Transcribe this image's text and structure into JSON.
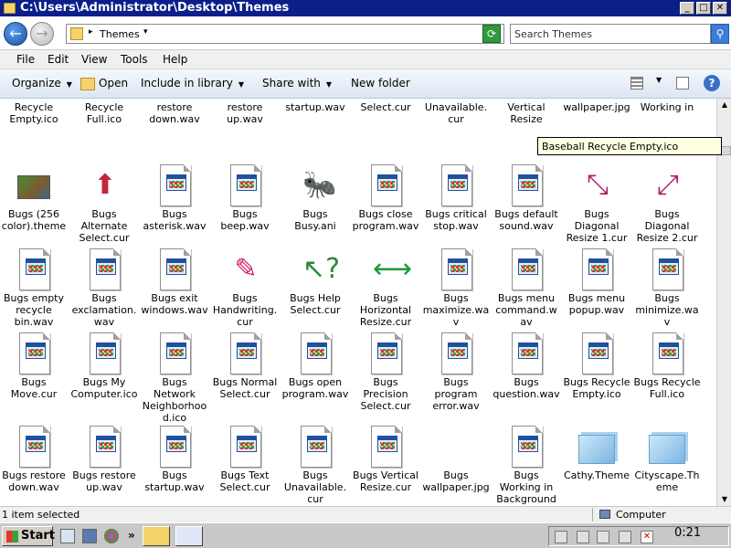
{
  "window": {
    "title": "C:\\Users\\Administrator\\Desktop\\Themes",
    "controls": {
      "minimize": "_",
      "maximize": "□",
      "close": "✕"
    }
  },
  "address": {
    "crumb": "Themes",
    "search_placeholder": "Search Themes"
  },
  "menu": [
    "File",
    "Edit",
    "View",
    "Tools",
    "Help"
  ],
  "toolbar": {
    "organize": "Organize",
    "open": "Open",
    "include_in_library": "Include in library",
    "share_with": "Share with",
    "new_folder": "New folder"
  },
  "tooltip": "Baseball Recycle Empty.ico",
  "items": [
    {
      "label": "Baseball Recycle Empty.ico",
      "kind": "partial"
    },
    {
      "label": "Baseball Recycle Full.ico",
      "kind": "partial"
    },
    {
      "label": "Baseball restore down.wav",
      "kind": "partial"
    },
    {
      "label": "Baseball restore up.wav",
      "kind": "partial"
    },
    {
      "label": "Baseball startup.wav",
      "kind": "partial"
    },
    {
      "label": "Baseball Text Select.cur",
      "kind": "partial"
    },
    {
      "label": "Baseball Unavailable. cur",
      "kind": "partial"
    },
    {
      "label": "Baseball Vertical Resize",
      "kind": "partial"
    },
    {
      "label": "Baseball wallpaper.jpg",
      "kind": "partial"
    },
    {
      "label": "Baseball Working in",
      "kind": "partial"
    },
    {
      "label": "Bugs (256 color).theme",
      "kind": "picture"
    },
    {
      "label": "Bugs Alternate Select.cur",
      "kind": "cursor",
      "glyph": "⬆",
      "color": "#c0283a"
    },
    {
      "label": "Bugs asterisk.wav",
      "kind": "sound"
    },
    {
      "label": "Bugs beep.wav",
      "kind": "sound"
    },
    {
      "label": "Bugs Busy.ani",
      "kind": "cursor",
      "glyph": "🐜",
      "color": "#111111"
    },
    {
      "label": "Bugs close program.wav",
      "kind": "sound"
    },
    {
      "label": "Bugs critical stop.wav",
      "kind": "sound"
    },
    {
      "label": "Bugs default sound.wav",
      "kind": "sound"
    },
    {
      "label": "Bugs Diagonal Resize 1.cur",
      "kind": "cursor",
      "glyph": "⤡",
      "color": "#b0206a"
    },
    {
      "label": "Bugs Diagonal Resize 2.cur",
      "kind": "cursor",
      "glyph": "⤢",
      "color": "#b0206a"
    },
    {
      "label": "Bugs empty recycle bin.wav",
      "kind": "sound"
    },
    {
      "label": "Bugs exclamation.wav",
      "kind": "sound"
    },
    {
      "label": "Bugs exit windows.wav",
      "kind": "sound"
    },
    {
      "label": "Bugs Handwriting.cur",
      "kind": "cursor",
      "glyph": "✎",
      "color": "#d0206a"
    },
    {
      "label": "Bugs Help Select.cur",
      "kind": "cursor",
      "glyph": "↖?",
      "color": "#2a8a3a"
    },
    {
      "label": "Bugs Horizontal Resize.cur",
      "kind": "cursor",
      "glyph": "⟷",
      "color": "#1f9a3a"
    },
    {
      "label": "Bugs maximize.wav",
      "kind": "sound"
    },
    {
      "label": "Bugs menu command.wav",
      "kind": "sound"
    },
    {
      "label": "Bugs menu popup.wav",
      "kind": "sound"
    },
    {
      "label": "Bugs minimize.wav",
      "kind": "sound"
    },
    {
      "label": "Bugs Move.cur",
      "kind": "sound"
    },
    {
      "label": "Bugs My Computer.ico",
      "kind": "sound"
    },
    {
      "label": "Bugs Network Neighborhood.ico",
      "kind": "sound"
    },
    {
      "label": "Bugs Normal Select.cur",
      "kind": "sound"
    },
    {
      "label": "Bugs open program.wav",
      "kind": "sound"
    },
    {
      "label": "Bugs Precision Select.cur",
      "kind": "sound"
    },
    {
      "label": "Bugs program error.wav",
      "kind": "sound"
    },
    {
      "label": "Bugs question.wav",
      "kind": "sound"
    },
    {
      "label": "Bugs Recycle Empty.ico",
      "kind": "sound"
    },
    {
      "label": "Bugs Recycle Full.ico",
      "kind": "sound"
    },
    {
      "label": "Bugs restore down.wav",
      "kind": "sound"
    },
    {
      "label": "Bugs restore up.wav",
      "kind": "sound"
    },
    {
      "label": "Bugs startup.wav",
      "kind": "sound"
    },
    {
      "label": "Bugs Text Select.cur",
      "kind": "sound"
    },
    {
      "label": "Bugs Unavailable.cur",
      "kind": "sound"
    },
    {
      "label": "Bugs Vertical Resize.cur",
      "kind": "sound"
    },
    {
      "label": "Bugs wallpaper.jpg",
      "kind": "blank"
    },
    {
      "label": "Bugs Working in Background",
      "kind": "sound"
    },
    {
      "label": "Cathy.Theme",
      "kind": "theme"
    },
    {
      "label": "Cityscape.Theme",
      "kind": "theme"
    }
  ],
  "status": {
    "selection": "1 item selected",
    "location": "Computer"
  },
  "taskbar": {
    "start": "Start",
    "clock": "0:21"
  }
}
